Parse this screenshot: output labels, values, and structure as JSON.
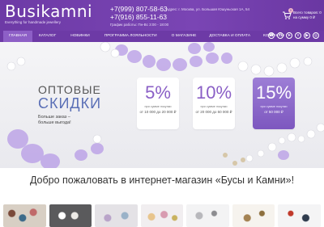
{
  "header": {
    "logo": "Busikamni",
    "tagline": "Everything for handmade jewellery",
    "phone1": "+7(999) 807-58-63",
    "phone2": "+7(916) 855-11-63",
    "hours": "График работы: Пн-Вс 3:00 - 18:00",
    "address": "Адрес: г. Москва, ул. Большая Юшуньская 1А, 54",
    "cart_line1": "Всего товаров: 0",
    "cart_line2": "на сумму 0 ₽",
    "cart_count": "0",
    "cart_total": "0 ₽",
    "cart_icon": "cart-icon"
  },
  "nav": {
    "items": [
      "Главная",
      "Каталог",
      "Новинки",
      "Программа лояльности",
      "О магазине",
      "Доставка и оплата",
      "Контакты"
    ],
    "social": [
      "viber-icon",
      "whatsapp-icon",
      "telegram-icon",
      "vk-icon",
      "youtube-icon",
      "instagram-icon"
    ]
  },
  "hero": {
    "title1": "Оптовые",
    "title2": "скидки",
    "subtitle1": "Больше заказ –",
    "subtitle2": "больше выгода!",
    "cards": [
      {
        "percent": "5%",
        "condition": "при сумме покупки",
        "range": "от 10 000 до 20 000 ₽"
      },
      {
        "percent": "10%",
        "condition": "при сумме покупки",
        "range": "от 20 000 до 50 000 ₽"
      },
      {
        "percent": "15%",
        "condition": "при сумме покупки",
        "range": "от 50 000 ₽"
      }
    ]
  },
  "welcome": "Добро пожаловать в интернет-магазин «Бусы и Камни»!",
  "colors": {
    "brand": "#6d3aa6",
    "nav_active": "#8d5fc6",
    "accent_blue": "#5a6fb6"
  }
}
